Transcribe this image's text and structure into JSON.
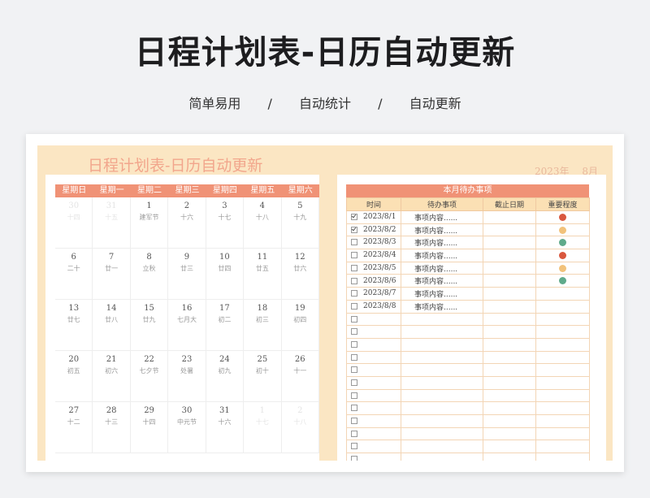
{
  "header": {
    "title": "日程计划表-日历自动更新",
    "subtitle": [
      "简单易用",
      "/",
      "自动统计",
      "/",
      "自动更新"
    ]
  },
  "sheet": {
    "title": "日程计划表-日历自动更新",
    "year": "2023年",
    "month": "8月"
  },
  "calendar": {
    "weekdays": [
      "星期日",
      "星期一",
      "星期二",
      "星期三",
      "星期四",
      "星期五",
      "星期六"
    ],
    "weeks": [
      [
        {
          "d": "30",
          "l": "十四",
          "dim": true
        },
        {
          "d": "31",
          "l": "十五",
          "dim": true
        },
        {
          "d": "1",
          "l": "建军节"
        },
        {
          "d": "2",
          "l": "十六"
        },
        {
          "d": "3",
          "l": "十七"
        },
        {
          "d": "4",
          "l": "十八"
        },
        {
          "d": "5",
          "l": "十九"
        }
      ],
      [
        {
          "d": "6",
          "l": "二十"
        },
        {
          "d": "7",
          "l": "廿一"
        },
        {
          "d": "8",
          "l": "立秋"
        },
        {
          "d": "9",
          "l": "廿三"
        },
        {
          "d": "10",
          "l": "廿四"
        },
        {
          "d": "11",
          "l": "廿五"
        },
        {
          "d": "12",
          "l": "廿六"
        }
      ],
      [
        {
          "d": "13",
          "l": "廿七"
        },
        {
          "d": "14",
          "l": "廿八"
        },
        {
          "d": "15",
          "l": "廿九"
        },
        {
          "d": "16",
          "l": "七月大"
        },
        {
          "d": "17",
          "l": "初二"
        },
        {
          "d": "18",
          "l": "初三"
        },
        {
          "d": "19",
          "l": "初四"
        }
      ],
      [
        {
          "d": "20",
          "l": "初五"
        },
        {
          "d": "21",
          "l": "初六"
        },
        {
          "d": "22",
          "l": "七夕节"
        },
        {
          "d": "23",
          "l": "处暑"
        },
        {
          "d": "24",
          "l": "初九"
        },
        {
          "d": "25",
          "l": "初十"
        },
        {
          "d": "26",
          "l": "十一"
        }
      ],
      [
        {
          "d": "27",
          "l": "十二"
        },
        {
          "d": "28",
          "l": "十三"
        },
        {
          "d": "29",
          "l": "十四"
        },
        {
          "d": "30",
          "l": "中元节"
        },
        {
          "d": "31",
          "l": "十六"
        },
        {
          "d": "1",
          "l": "十七",
          "dim": true
        },
        {
          "d": "2",
          "l": "十八",
          "dim": true
        }
      ]
    ]
  },
  "todo": {
    "title": "本月待办事项",
    "columns": [
      "时间",
      "待办事项",
      "截止日期",
      "重要程度"
    ],
    "rows": [
      {
        "checked": true,
        "date": "2023/8/1",
        "item": "事项内容......",
        "priority": "high"
      },
      {
        "checked": true,
        "date": "2023/8/2",
        "item": "事项内容......",
        "priority": "medium"
      },
      {
        "checked": false,
        "date": "2023/8/3",
        "item": "事项内容......",
        "priority": "low"
      },
      {
        "checked": false,
        "date": "2023/8/4",
        "item": "事项内容......",
        "priority": "high"
      },
      {
        "checked": false,
        "date": "2023/8/5",
        "item": "事项内容......",
        "priority": "medium"
      },
      {
        "checked": false,
        "date": "2023/8/6",
        "item": "事项内容......",
        "priority": "low"
      },
      {
        "checked": false,
        "date": "2023/8/7",
        "item": "事项内容......",
        "priority": ""
      },
      {
        "checked": false,
        "date": "2023/8/8",
        "item": "事项内容......",
        "priority": ""
      },
      {
        "checked": false,
        "date": "",
        "item": "",
        "priority": ""
      },
      {
        "checked": false,
        "date": "",
        "item": "",
        "priority": ""
      },
      {
        "checked": false,
        "date": "",
        "item": "",
        "priority": ""
      },
      {
        "checked": false,
        "date": "",
        "item": "",
        "priority": ""
      },
      {
        "checked": false,
        "date": "",
        "item": "",
        "priority": ""
      },
      {
        "checked": false,
        "date": "",
        "item": "",
        "priority": ""
      },
      {
        "checked": false,
        "date": "",
        "item": "",
        "priority": ""
      },
      {
        "checked": false,
        "date": "",
        "item": "",
        "priority": ""
      },
      {
        "checked": false,
        "date": "",
        "item": "",
        "priority": ""
      },
      {
        "checked": false,
        "date": "",
        "item": "",
        "priority": ""
      },
      {
        "checked": false,
        "date": "",
        "item": "",
        "priority": ""
      },
      {
        "checked": false,
        "date": "",
        "item": "",
        "priority": ""
      },
      {
        "checked": false,
        "date": "",
        "item": "",
        "priority": ""
      }
    ]
  },
  "colors": {
    "accent": "#f09276",
    "priority_high": "#d9573e",
    "priority_medium": "#f2c27a",
    "priority_low": "#5faa8a"
  }
}
